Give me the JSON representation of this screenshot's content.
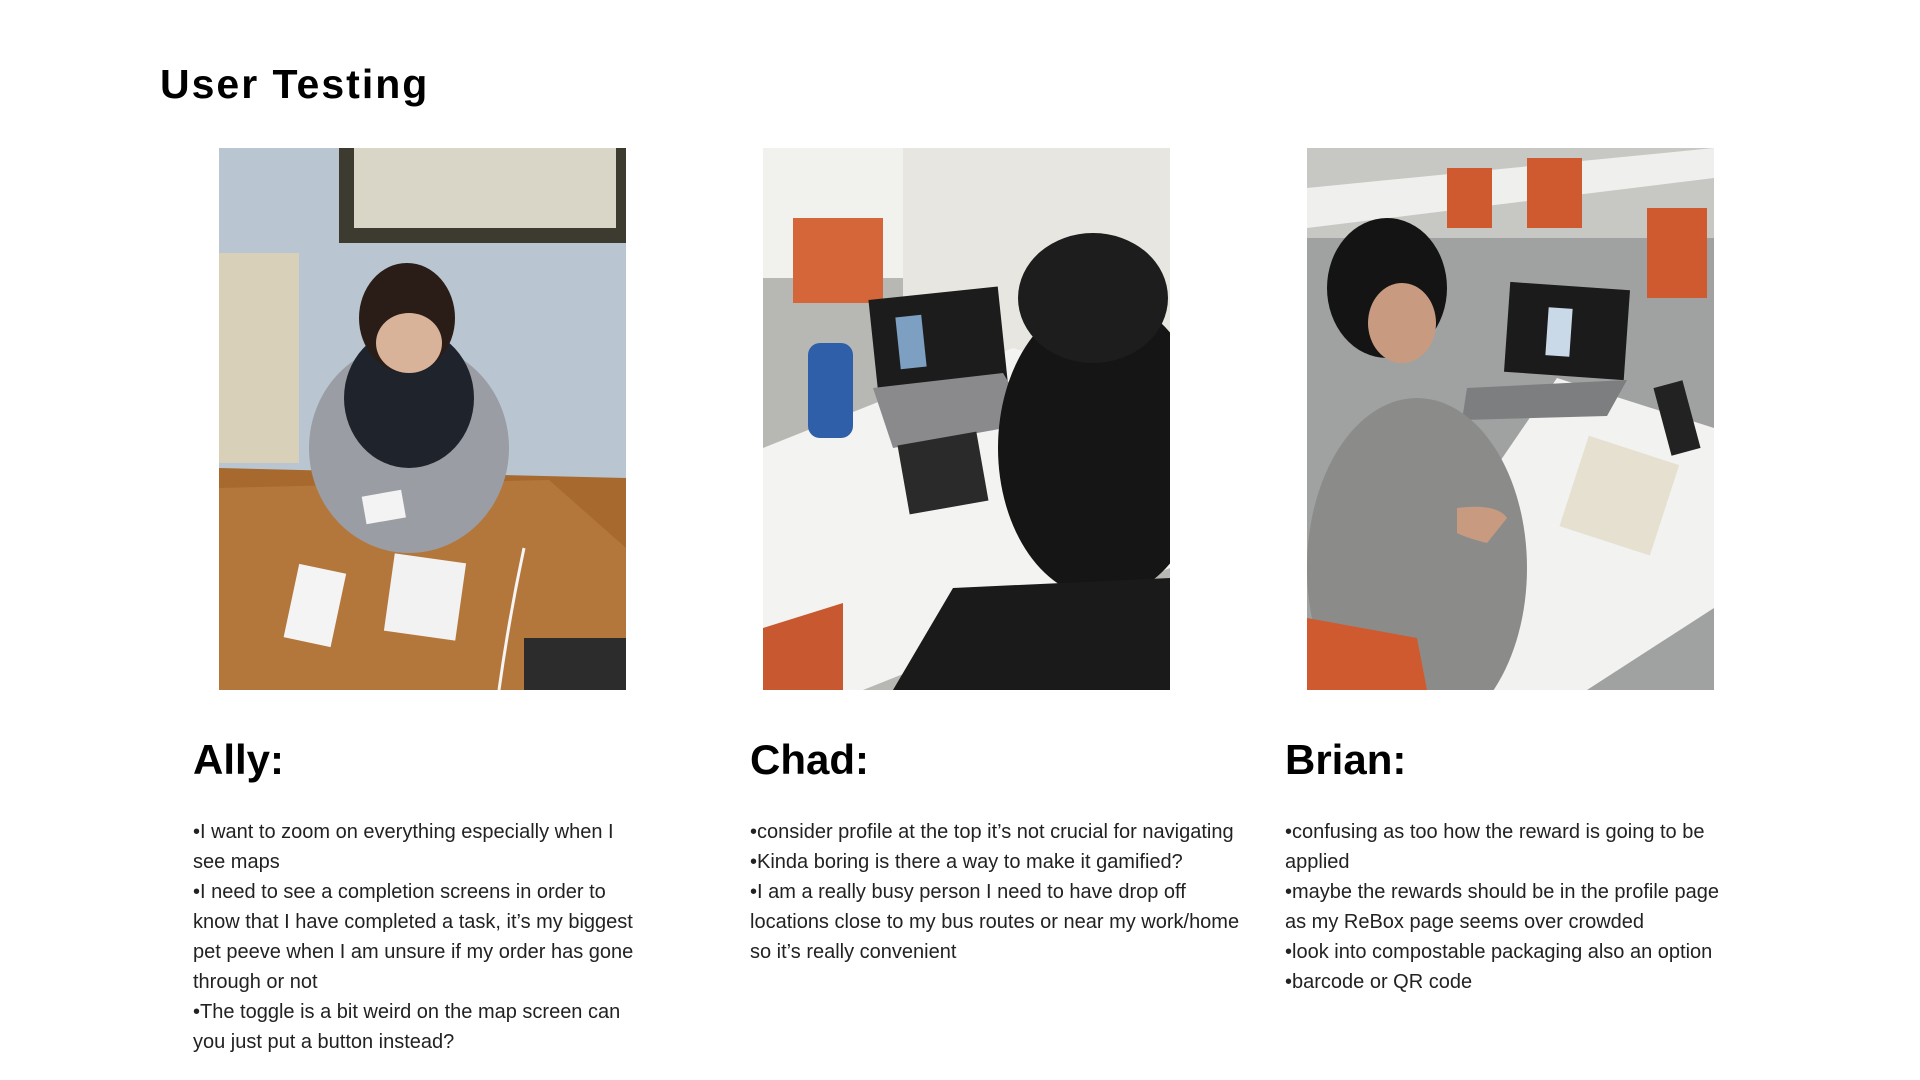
{
  "page": {
    "title": "User Testing"
  },
  "participants": [
    {
      "name": "Ally:",
      "photo": "photo-woman-testing-paper-prototype",
      "notes": [
        "•I want to zoom on everything especially when I see maps",
        "•I need to see a completion screens in order to know that I have completed a task, it’s my biggest pet peeve when I am unsure if my order has gone through or not",
        "•The toggle is a bit weird on the map screen can you just put a button instead?"
      ]
    },
    {
      "name": "Chad:",
      "photo": "photo-person-testing-laptop-prototype",
      "notes": [
        "•consider profile at the top it’s not crucial for navigating",
        "•Kinda boring is there a way to make it gamified?",
        "•I am a really busy person I need to have drop off locations close to my bus routes or near my work/home so it’s really convenient"
      ]
    },
    {
      "name": "Brian:",
      "photo": "photo-man-testing-laptop-prototype",
      "notes": [
        "•confusing as too how the reward is going to be applied",
        "•maybe the rewards should be in the profile page as my ReBox page seems over crowded",
        "•look into compostable packaging also an option",
        "•barcode or QR code"
      ]
    }
  ]
}
